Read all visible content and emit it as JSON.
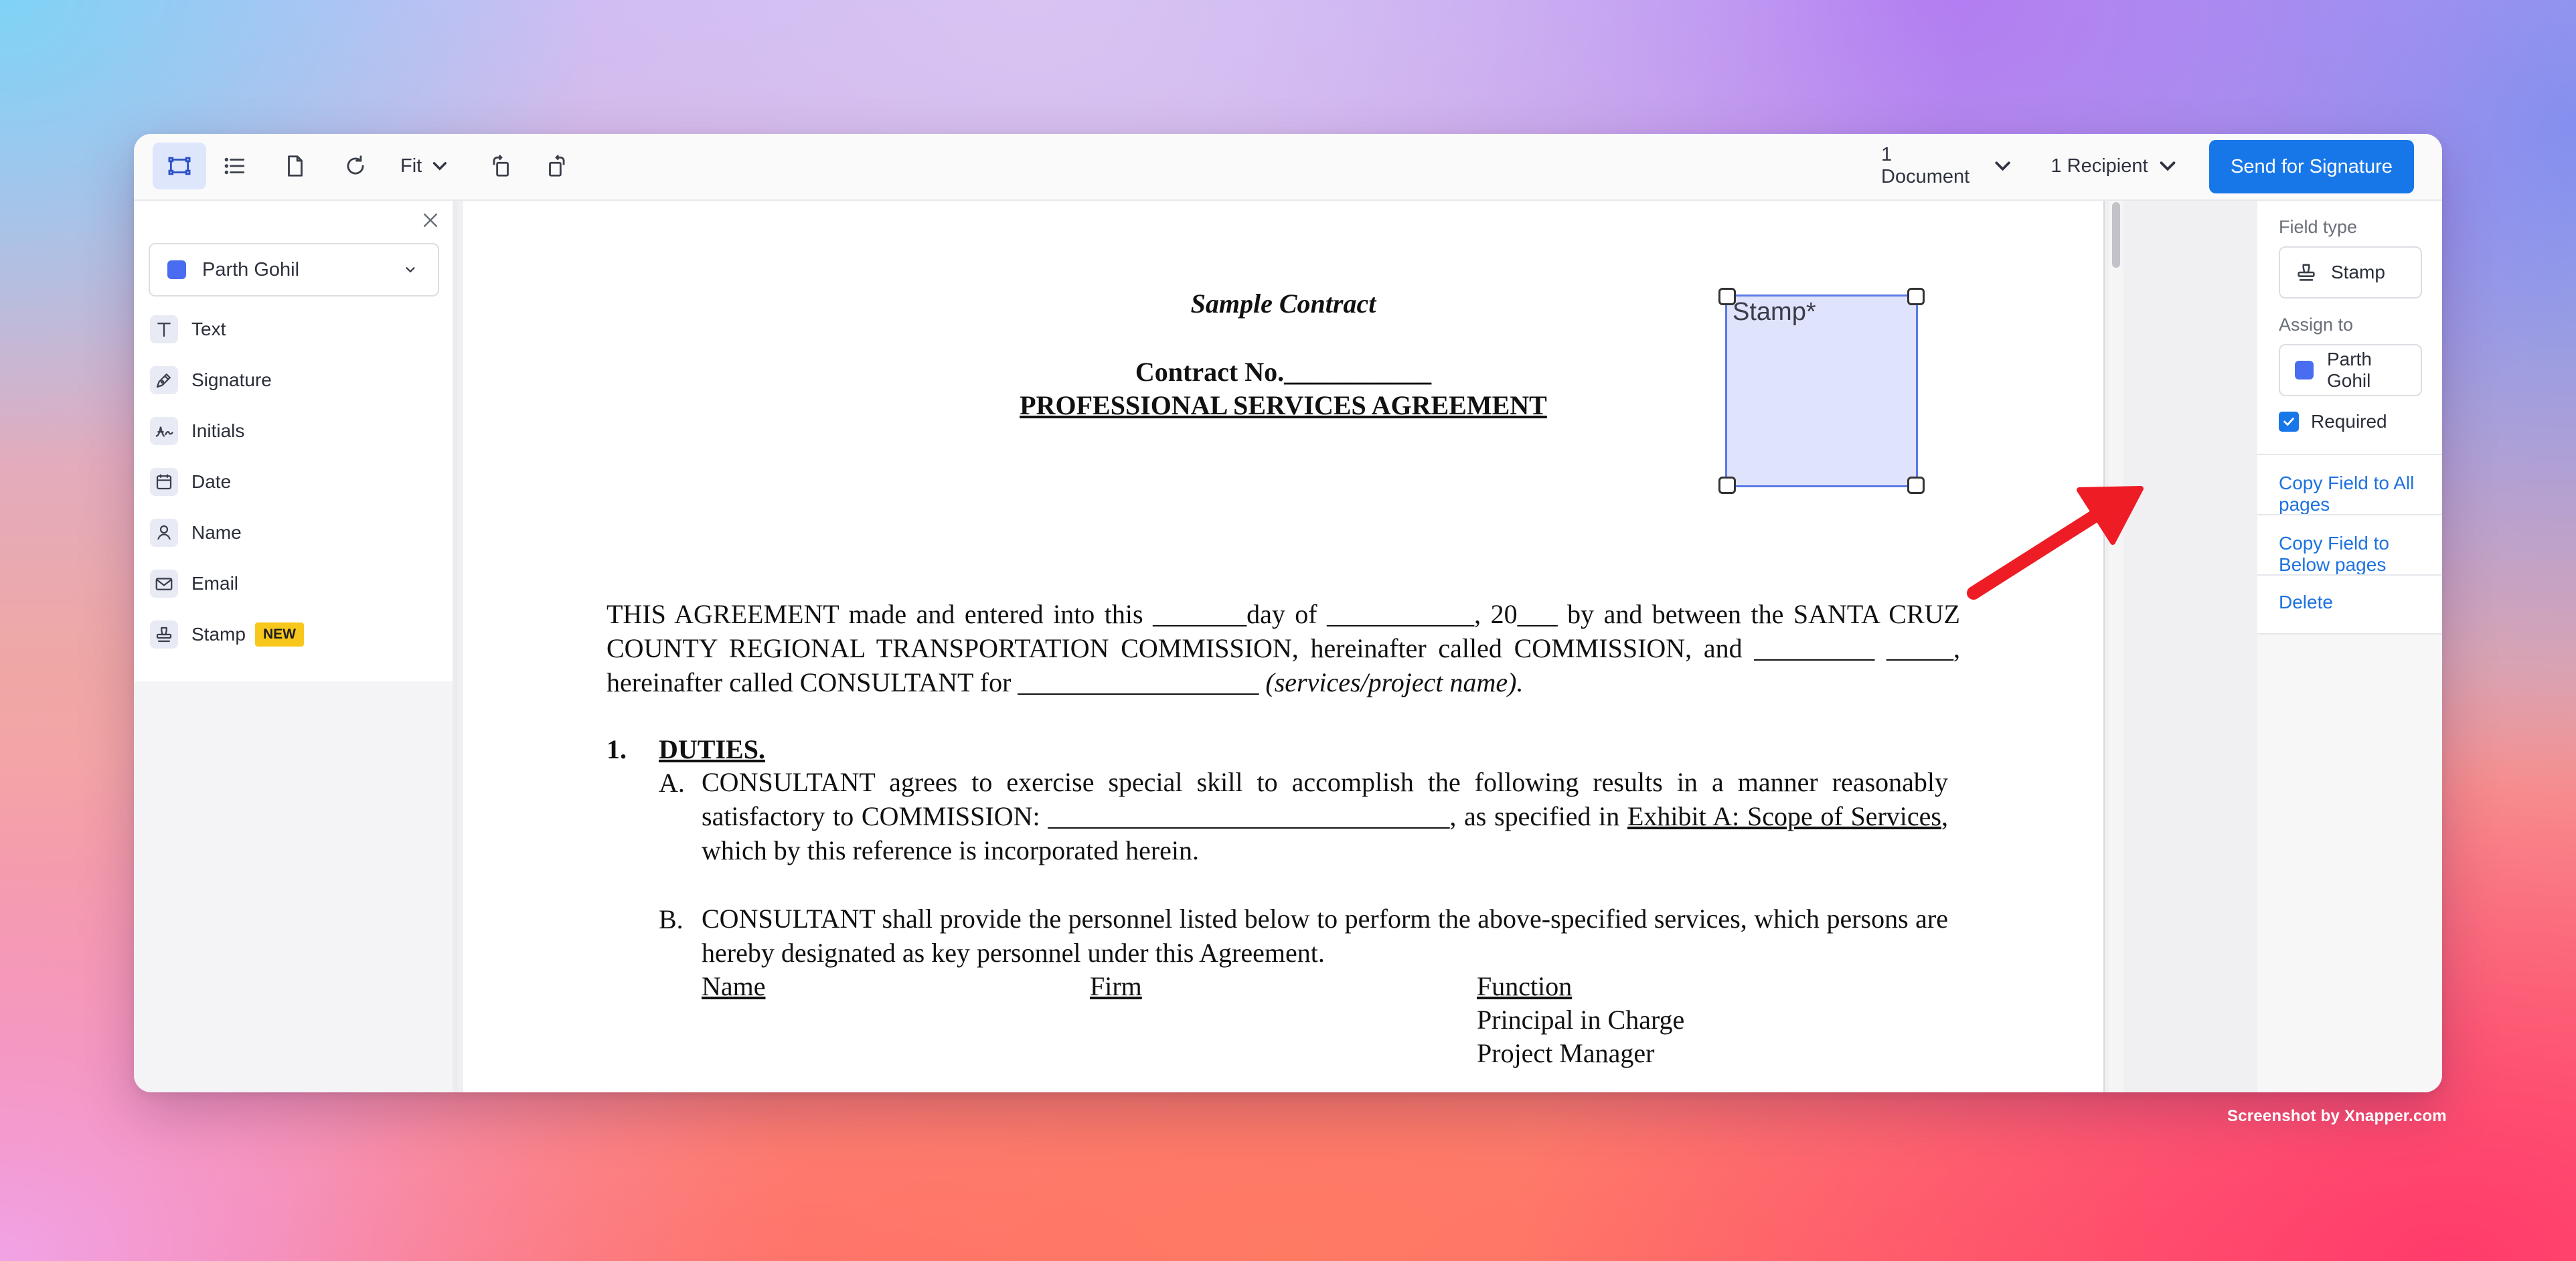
{
  "toolbar": {
    "fit_label": "Fit",
    "documents_label": "1 Document",
    "recipients_label": "1 Recipient",
    "send_label": "Send for Signature"
  },
  "left_panel": {
    "recipient": {
      "name": "Parth Gohil",
      "color": "#4a6cf0"
    },
    "fields": [
      {
        "label": "Text",
        "icon": "text-icon"
      },
      {
        "label": "Signature",
        "icon": "pen-icon"
      },
      {
        "label": "Initials",
        "icon": "initials-icon"
      },
      {
        "label": "Date",
        "icon": "calendar-icon"
      },
      {
        "label": "Name",
        "icon": "person-icon"
      },
      {
        "label": "Email",
        "icon": "envelope-icon"
      },
      {
        "label": "Stamp",
        "icon": "stamp-icon",
        "badge": "NEW"
      }
    ]
  },
  "document": {
    "title": "Sample Contract",
    "contract_no": "Contract No.___________",
    "agreement_title": "PROFESSIONAL SERVICES AGREEMENT",
    "intro_part1": "THIS AGREEMENT made and entered into this _______day of ___________, 20___ by and between the SANTA CRUZ COUNTY REGIONAL TRANSPORTATION COMMISSION, hereinafter called COMMISSION, and _________ _____, hereinafter called CONSULTANT for __________________ ",
    "intro_italic": "(services/project name).",
    "section_number": "1.",
    "section_title": "DUTIES.",
    "item_a_label": "A.",
    "item_a_text1": "CONSULTANT agrees to exercise special skill to accomplish the following results in a manner reasonably satisfactory to COMMISSION: ______________________________, as specified in ",
    "item_a_link": "Exhibit A: Scope of Services",
    "item_a_text2": ", which by this reference is incorporated herein.",
    "item_b_label": "B.",
    "item_b_text": "CONSULTANT shall provide the personnel listed below to perform the above-specified services, which persons are hereby designated as key personnel under this Agreement.",
    "col_name": "Name",
    "col_firm": "Firm",
    "col_function": "Function",
    "functions": [
      "Principal in Charge",
      "Project Manager"
    ],
    "stamp_field_label": "Stamp*"
  },
  "right_panel": {
    "field_type_label": "Field type",
    "field_type_value": "Stamp",
    "assign_to_label": "Assign to",
    "assign_to_value": "Parth Gohil",
    "required_label": "Required",
    "required_checked": true,
    "copy_all_label": "Copy Field to All pages",
    "copy_below_label": "Copy Field to Below pages",
    "delete_label": "Delete"
  },
  "annotation": {
    "arrow_color": "#ee1c24"
  },
  "credit": "Screenshot by Xnapper.com"
}
